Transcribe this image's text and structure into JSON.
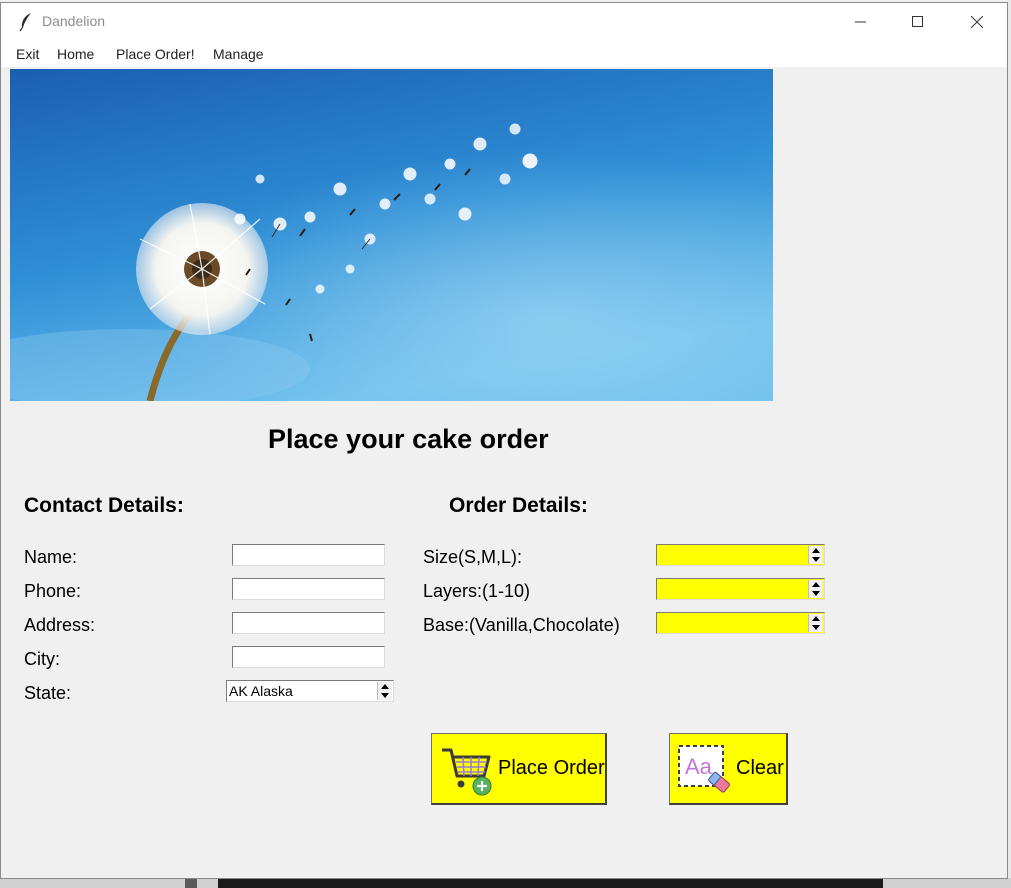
{
  "window": {
    "title": "Dandelion"
  },
  "menu": {
    "items": [
      "Exit",
      "Home",
      "Place Order!",
      "Manage"
    ]
  },
  "page": {
    "heading": "Place your cake order",
    "contact_heading": "Contact Details:",
    "order_heading": "Order Details:"
  },
  "contact": {
    "name_label": "Name:",
    "phone_label": "Phone:",
    "address_label": "Address:",
    "city_label": "City:",
    "state_label": "State:",
    "name_value": "",
    "phone_value": "",
    "address_value": "",
    "city_value": "",
    "state_value": "AK Alaska"
  },
  "order": {
    "size_label": "Size(S,M,L):",
    "layers_label": "Layers:(1-10)",
    "base_label": "Base:(Vanilla,Chocolate)",
    "size_value": "",
    "layers_value": "",
    "base_value": ""
  },
  "buttons": {
    "place_order": "Place Order",
    "clear": "Clear"
  },
  "colors": {
    "button_bg": "#ffff00",
    "order_field_bg": "#ffff00",
    "sky_top": "#1c66b6",
    "sky_bottom": "#5ab4ea"
  },
  "icons": {
    "app": "feather-icon",
    "place_order": "shopping-cart-add-icon",
    "clear": "clear-format-eraser-icon"
  }
}
